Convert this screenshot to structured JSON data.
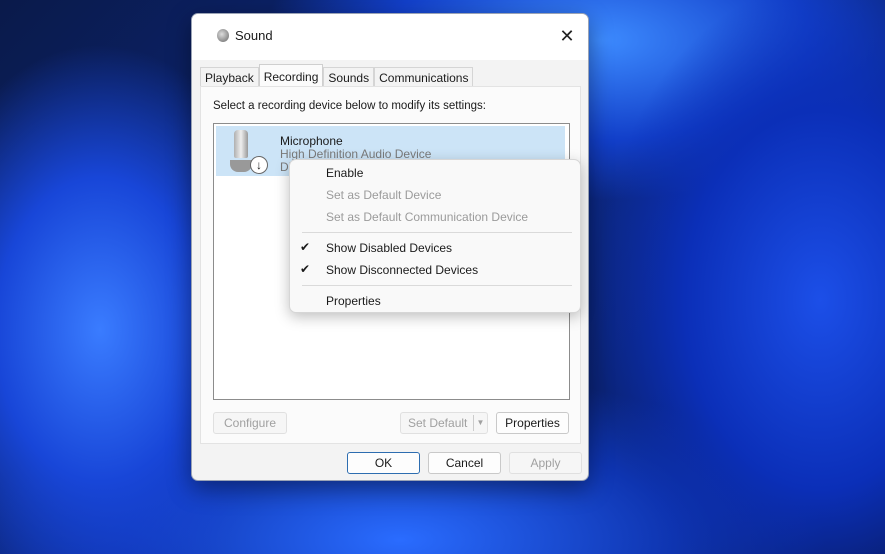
{
  "window": {
    "title": "Sound",
    "close_icon": "close-icon"
  },
  "tabs": [
    {
      "label": "Playback"
    },
    {
      "label": "Recording"
    },
    {
      "label": "Sounds"
    },
    {
      "label": "Communications"
    }
  ],
  "active_tab": "Recording",
  "instruction": "Select a recording device below to modify its settings:",
  "devices": [
    {
      "name": "Microphone",
      "description": "High Definition Audio Device",
      "status": "Disabled",
      "icon": "microphone-icon"
    }
  ],
  "buttons": {
    "configure": "Configure",
    "set_default": "Set Default",
    "properties": "Properties",
    "ok": "OK",
    "cancel": "Cancel",
    "apply": "Apply"
  },
  "context_menu": [
    {
      "label": "Enable",
      "enabled": true
    },
    {
      "label": "Set as Default Device",
      "enabled": false
    },
    {
      "label": "Set as Default Communication Device",
      "enabled": false
    },
    {
      "label": "Show Disabled Devices",
      "checked": true
    },
    {
      "label": "Show Disconnected Devices",
      "checked": true
    },
    {
      "label": "Properties",
      "enabled": true
    }
  ]
}
